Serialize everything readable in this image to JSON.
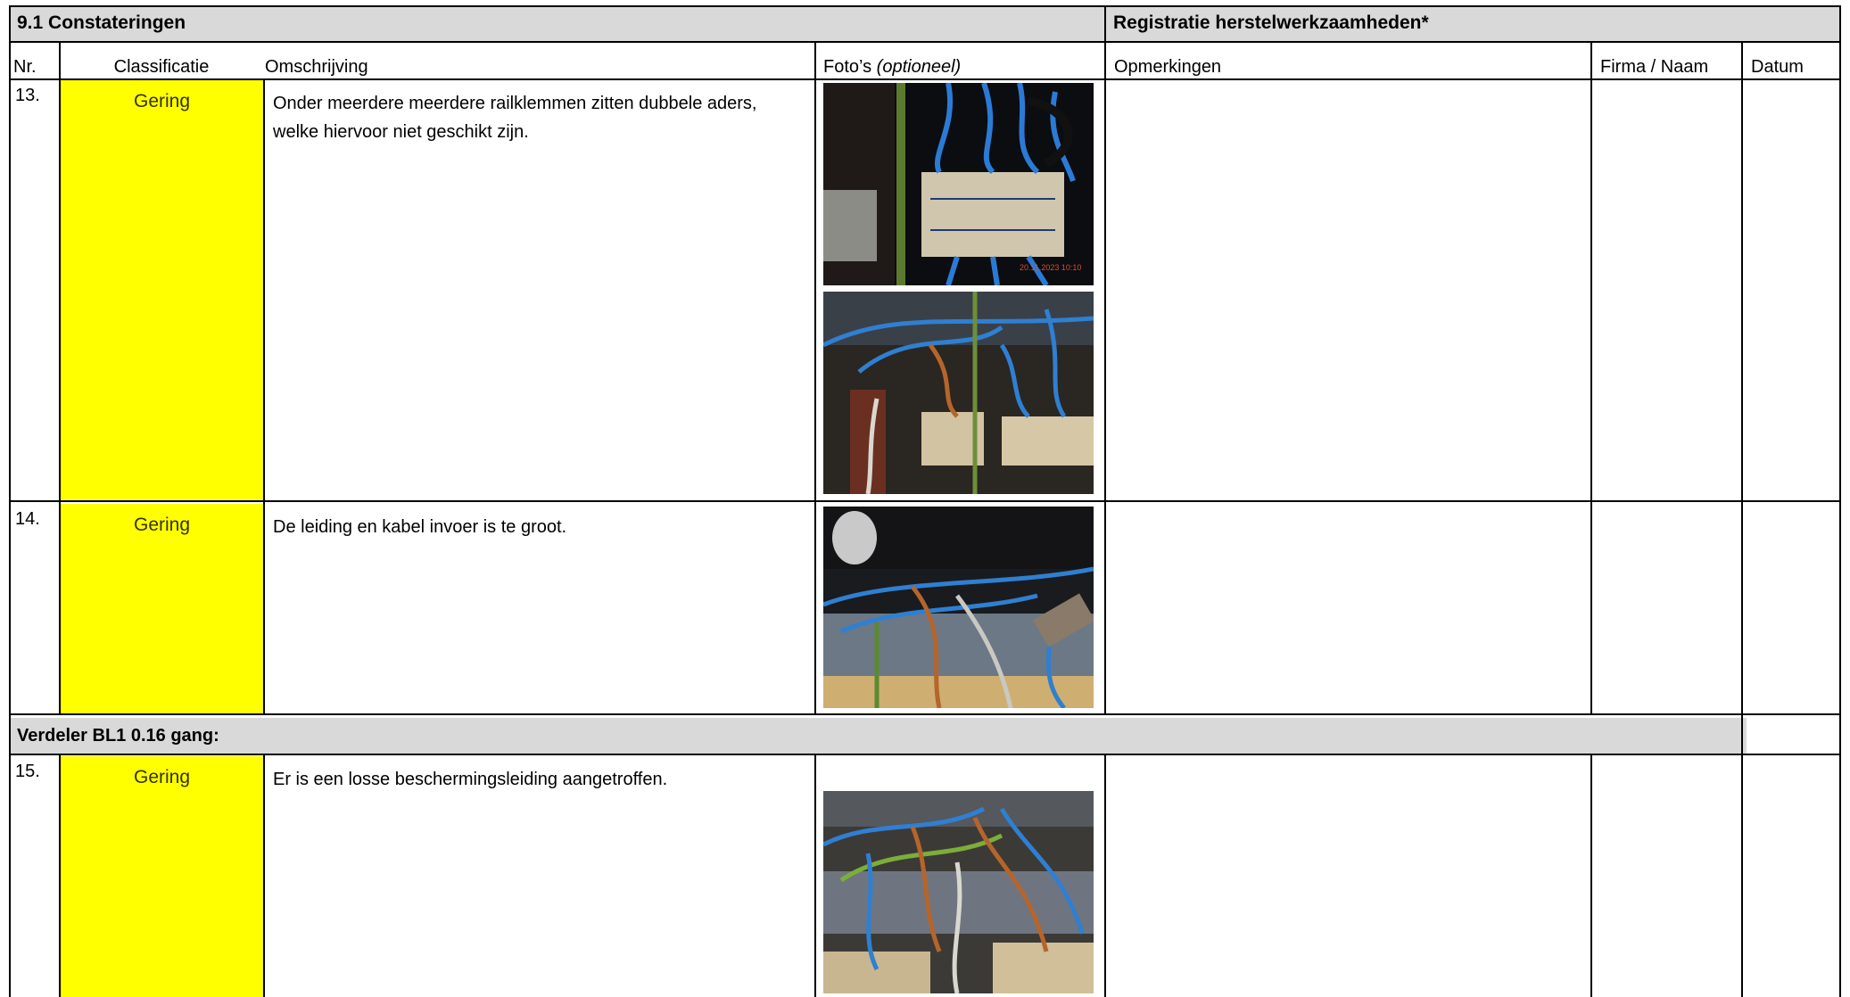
{
  "section_title": "9.1 Constateringen",
  "registration_title": "Registratie herstelwerkzaamheden*",
  "columns": {
    "nr": "Nr.",
    "classificatie": "Classificatie",
    "omschrijving": "Omschrijving",
    "fotos": "Foto’s",
    "fotos_optional": "(optioneel)",
    "opmerkingen": "Opmerkingen",
    "firma": "Firma / Naam",
    "datum": "Datum"
  },
  "rows": [
    {
      "nr": "13.",
      "classificatie": "Gering",
      "omschrijving_line1": "Onder meerdere meerdere railklemmen zitten dubbele aders,",
      "omschrijving_line2": "welke hiervoor niet geschikt zijn.",
      "photo_count": 2
    },
    {
      "nr": "14.",
      "classificatie": "Gering",
      "omschrijving_line1": "De leiding en kabel invoer is te groot.",
      "omschrijving_line2": "",
      "photo_count": 1
    }
  ],
  "subsection_title": "Verdeler BL1 0.16 gang:",
  "rows_after": [
    {
      "nr": "15.",
      "classificatie": "Gering",
      "omschrijving_line1": "Er is een losse beschermingsleiding aangetroffen.",
      "photo_count": 1
    }
  ],
  "colors": {
    "header_gray": "#d9d9d9",
    "classification_yellow": "#ffff00"
  },
  "photo_timestamp": "20.11.2023 10:10"
}
